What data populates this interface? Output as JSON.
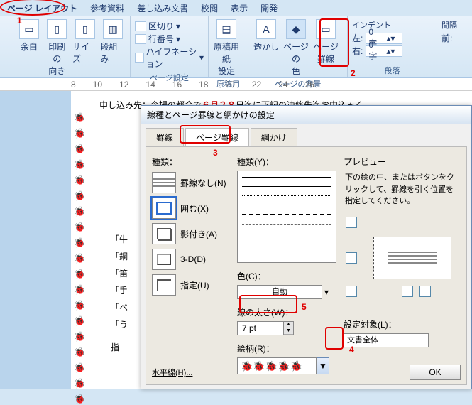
{
  "tabs": {
    "layout": "ページ レイアウト",
    "ref": "参考資料",
    "mailmerge": "差し込み文書",
    "review": "校閲",
    "view": "表示",
    "dev": "開発"
  },
  "ribbon": {
    "margin": "余白",
    "orient": "印刷の\n向き",
    "size": "サイズ",
    "columns": "段組み",
    "breaks": "区切り",
    "linenum": "行番号",
    "hyphen": "ハイフネーション",
    "grp_page": "ページ設定",
    "ms_paper": "原稿用紙\n設定",
    "grp_paper": "原稿用紙",
    "watermark": "透かし",
    "pagecolor": "ページの\n色",
    "pageborder": "ページ\n罫線",
    "grp_bg": "ページの背景",
    "indent": "インデント",
    "left": "左:",
    "right": "右:",
    "zero": "0 字",
    "spacing": "間隔",
    "before": "前:",
    "grp_para": "段落"
  },
  "ruler": [
    "8",
    "10",
    "12",
    "14",
    "16",
    "18",
    "20",
    "22",
    "24",
    "26"
  ],
  "doc": {
    "line1_a": "申し込み先：",
    "line1_b": "今場の都合で",
    "line1_c": "６月２８",
    "line1_d": "日迄に下記の連絡先迄お申込みく",
    "q1": "「牛",
    "q2": "「銅",
    "q3": "「笛",
    "q4": "「手",
    "q5": "「ペ",
    "q6": "「う",
    "q7": "指"
  },
  "dialog": {
    "title": "線種とページ罫線と網かけの設定",
    "tab_border": "罫線",
    "tab_page": "ページ罫線",
    "tab_shading": "網かけ",
    "sect_type": "種類：",
    "sect_style": "種類(Y)：",
    "sect_color": "色(C)：",
    "sect_width": "線の太さ(W)：",
    "sect_art": "絵柄(R)：",
    "t_none": "罫線なし(N)",
    "t_box": "囲む(X)",
    "t_shadow": "影付き(A)",
    "t_3d": "3-D(D)",
    "t_custom": "指定(U)",
    "color_auto": "自動",
    "width_val": "7 pt",
    "preview": "プレビュー",
    "preview_hint": "下の絵の中、またはボタンをクリックして、罫線を引く位置を指定してください。",
    "target_lbl": "設定対象(L)：",
    "target_val": "文書全体",
    "hlink": "水平線(H)...",
    "ok": "OK"
  },
  "annot": {
    "n1": "1",
    "n2": "2",
    "n3": "3",
    "n4": "4",
    "n5": "5"
  }
}
